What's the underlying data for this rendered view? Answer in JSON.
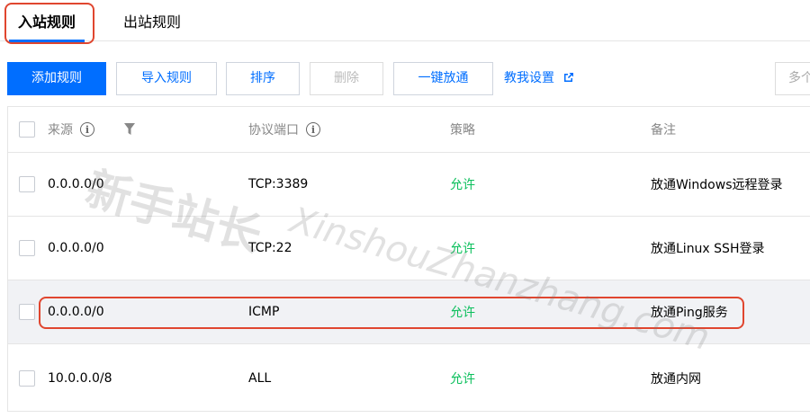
{
  "tabs": {
    "inbound": "入站规则",
    "outbound": "出站规则"
  },
  "toolbar": {
    "add": "添加规则",
    "import": "导入规则",
    "sort": "排序",
    "delete": "删除",
    "open_all": "一键放通",
    "tutorial": "教我设置",
    "more": "多个"
  },
  "table": {
    "headers": {
      "source": "来源",
      "protocol_port": "协议端口",
      "policy": "策略",
      "remark": "备注"
    },
    "rows": [
      {
        "source": "0.0.0.0/0",
        "protocol_port": "TCP:3389",
        "policy": "允许",
        "remark": "放通Windows远程登录"
      },
      {
        "source": "0.0.0.0/0",
        "protocol_port": "TCP:22",
        "policy": "允许",
        "remark": "放通Linux SSH登录"
      },
      {
        "source": "0.0.0.0/0",
        "protocol_port": "ICMP",
        "policy": "允许",
        "remark": "放通Ping服务"
      },
      {
        "source": "10.0.0.0/8",
        "protocol_port": "ALL",
        "policy": "允许",
        "remark": "放通内网"
      }
    ]
  },
  "watermark": {
    "cn": "新手站长",
    "en": "XinshouZhanzhang.com"
  },
  "colors": {
    "primary": "#006eff",
    "allow": "#0abf5b",
    "highlight": "#e0462f"
  }
}
